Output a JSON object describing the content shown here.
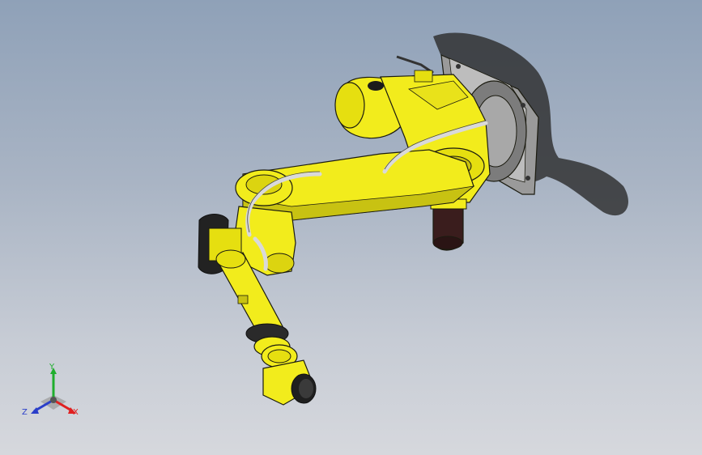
{
  "viewport": {
    "background_top": "#8fa1b8",
    "background_bottom": "#d6d8dd"
  },
  "model": {
    "body_color": "#f2ec1c",
    "shade_color": "#b9b40f",
    "outline_color": "#1b1b10",
    "cable_color": "#d9d9d9",
    "motor_color": "#222222",
    "base_plate_color": "#8e8e8e"
  },
  "triad": {
    "x_label": "X",
    "y_label": "Y",
    "z_label": "Z",
    "x_color": "#e02020",
    "y_color": "#1fae2d",
    "z_color": "#2a3ec9"
  }
}
